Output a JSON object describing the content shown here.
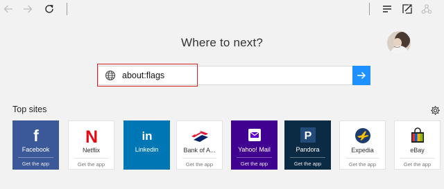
{
  "toolbar": {
    "back_icon": "back-arrow-icon",
    "forward_icon": "forward-arrow-icon",
    "refresh_icon": "refresh-icon",
    "hub_icon": "hub-icon",
    "note_icon": "web-note-icon",
    "share_icon": "share-icon"
  },
  "main": {
    "heading": "Where to next?"
  },
  "search": {
    "value": "about:flags",
    "icon": "globe-icon",
    "go_icon": "arrow-right-icon",
    "accent": "#1e90ff",
    "highlight_color": "#d32020"
  },
  "top_sites": {
    "title": "Top sites",
    "settings_icon": "gear-icon",
    "tiles": [
      {
        "name": "Facebook",
        "app": "Get the app",
        "color": "#3b5998",
        "icon": "facebook-logo-icon"
      },
      {
        "name": "Netflix",
        "app": "Get the app",
        "color": "#ffffff",
        "icon": "netflix-logo-icon"
      },
      {
        "name": "Linkedin",
        "app": "",
        "color": "#0077b5",
        "icon": "linkedin-logo-icon"
      },
      {
        "name": "Bank of A...",
        "app": "Get the app",
        "color": "#ffffff",
        "icon": "bank-of-america-logo-icon"
      },
      {
        "name": "Yahoo! Mail",
        "app": "Get the app",
        "color": "#400090",
        "icon": "yahoo-mail-logo-icon"
      },
      {
        "name": "Pandora",
        "app": "Get the app",
        "color": "#0b2a44",
        "icon": "pandora-logo-icon"
      },
      {
        "name": "Expedia",
        "app": "Get the app",
        "color": "#ffffff",
        "icon": "expedia-logo-icon"
      },
      {
        "name": "eBay",
        "app": "Get the app",
        "color": "#ffffff",
        "icon": "ebay-logo-icon"
      }
    ]
  }
}
